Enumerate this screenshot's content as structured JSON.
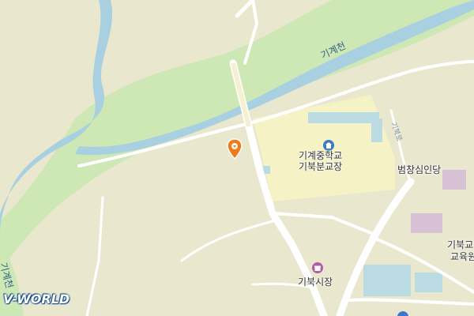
{
  "map": {
    "colors": {
      "land": "#eae7cf",
      "water": "#a8d0e0",
      "greenbelt": "#cde8b4",
      "road": "#ffffff",
      "school_zone": "#f5f2c6",
      "building": "#b9dbe1",
      "pin": "#f07a1a",
      "poi_purple": "#b05ca8",
      "poi_blue": "#3c78c8"
    },
    "labels": {
      "river_top": "기계천",
      "river_left": "기계천",
      "road_small": "기북로",
      "school_line1": "기계중학교",
      "school_line2": "기북분교장",
      "temple": "범창심인당",
      "market": "기북시장",
      "office_line1": "기북교",
      "office_line2": "교육원"
    },
    "icons": {
      "pin": "location-pin-icon",
      "school": "school-icon",
      "market": "market-icon",
      "edge_poi": "poi-marker-icon"
    },
    "branding": {
      "logo": "V-WORLD"
    }
  }
}
